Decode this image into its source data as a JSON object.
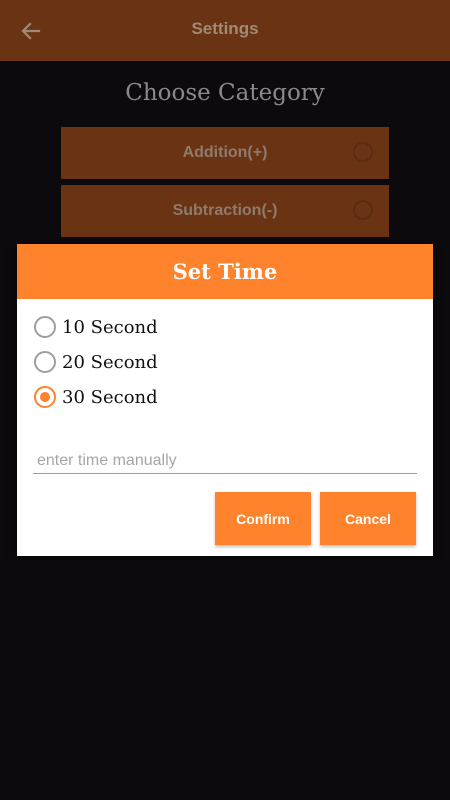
{
  "appbar": {
    "title": "Settings",
    "back_icon": "arrow-left-icon",
    "color": "#6a3414"
  },
  "main": {
    "heading": "Choose Category",
    "categories": [
      {
        "label": "Addition(+)",
        "selected": false
      },
      {
        "label": "Subtraction(-)",
        "selected": false
      }
    ]
  },
  "dialog": {
    "title": "Set Time",
    "options": [
      {
        "label": "10 Second",
        "checked": false
      },
      {
        "label": "20 Second",
        "checked": false
      },
      {
        "label": "30 Second",
        "checked": true
      }
    ],
    "manual_input": {
      "value": "",
      "placeholder": "enter time manually"
    },
    "confirm_label": "Confirm",
    "cancel_label": "Cancel",
    "accent_color": "#ff822c"
  }
}
